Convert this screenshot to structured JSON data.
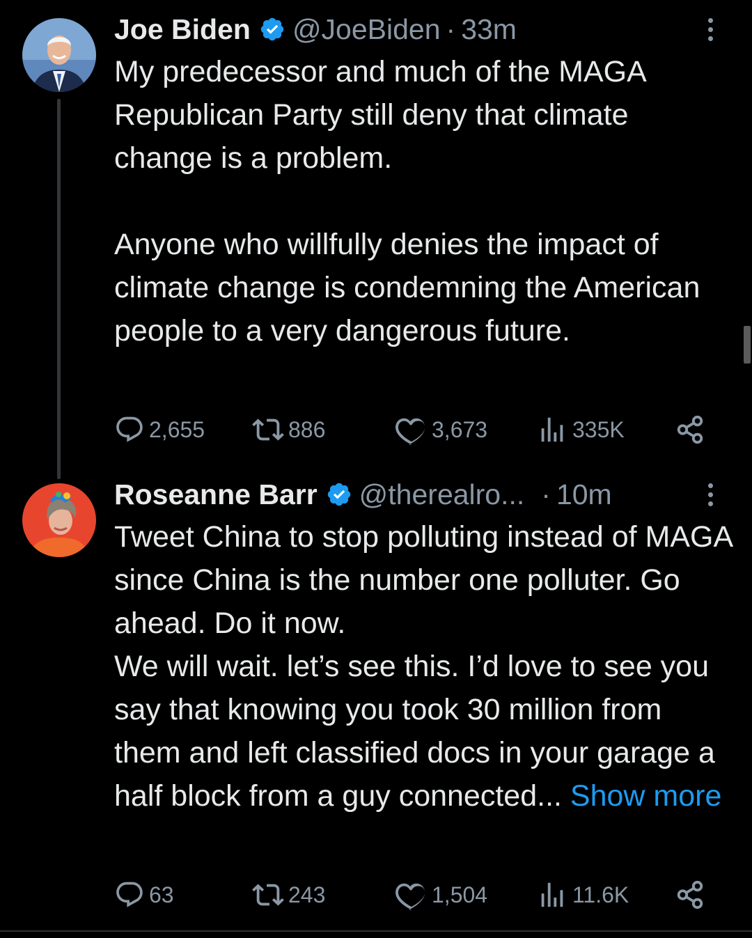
{
  "tweets": [
    {
      "author": {
        "name": "Joe Biden",
        "handle": "@JoeBiden",
        "verified": true
      },
      "separator": "·",
      "time": "33m",
      "text_paragraphs": [
        "My predecessor and much of the MAGA Republican Party still deny that climate change is a problem.",
        "Anyone who willfully denies the impact of climate change is condemning the American people to a very dangerous future."
      ],
      "stats": {
        "replies": "2,655",
        "retweets": "886",
        "likes": "3,673",
        "views": "335K"
      }
    },
    {
      "author": {
        "name": "Roseanne Barr",
        "handle": "@therealro...",
        "verified": true
      },
      "separator": "·",
      "time": "10m",
      "text_lines": [
        "Tweet China to stop polluting instead of MAGA since China is the number one polluter. Go ahead. Do it now.",
        "We will wait.  let’s see this. I’d love to see you say that knowing you took 30 million from them and left classified docs in your garage a half block from a guy connected..."
      ],
      "show_more": "Show more",
      "stats": {
        "replies": "63",
        "retweets": "243",
        "likes": "1,504",
        "views": "11.6K"
      }
    }
  ],
  "colors": {
    "background": "#000000",
    "text": "#e7e9ea",
    "secondary_text": "#8b98a5",
    "link": "#1d9bf0",
    "verified_badge": "#1d9bf0"
  },
  "icons": [
    "verified-badge-icon",
    "more-icon",
    "reply-icon",
    "retweet-icon",
    "like-icon",
    "views-icon",
    "share-icon"
  ]
}
